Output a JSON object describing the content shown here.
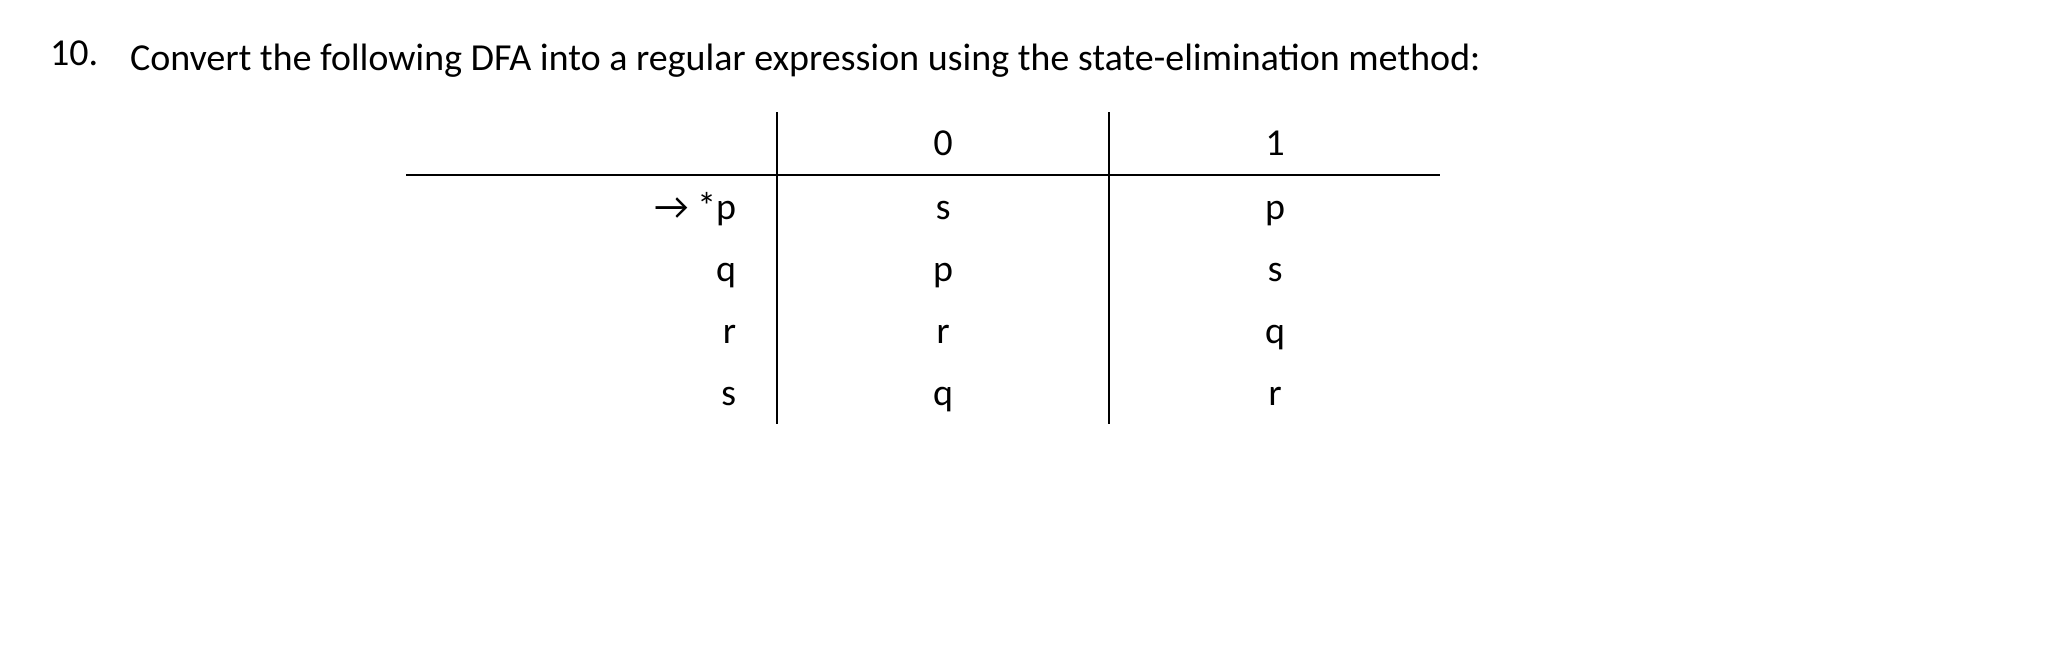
{
  "question": {
    "number": "10.",
    "text": "Convert the following DFA into a regular expression using the state-elimination method:"
  },
  "table": {
    "headers": {
      "state": "",
      "col0": "0",
      "col1": "1"
    },
    "rows": [
      {
        "state": "→ *p",
        "col0": "s",
        "col1": "p"
      },
      {
        "state": "q",
        "col0": "p",
        "col1": "s"
      },
      {
        "state": "r",
        "col0": "r",
        "col1": "q"
      },
      {
        "state": "s",
        "col0": "q",
        "col1": "r"
      }
    ]
  }
}
